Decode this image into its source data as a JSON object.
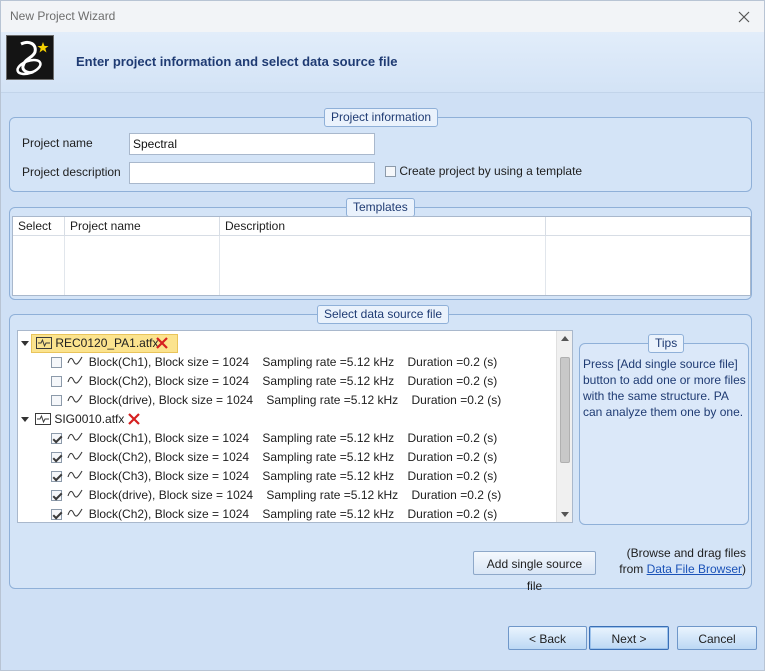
{
  "window": {
    "title": "New Project Wizard"
  },
  "header": {
    "title": "Enter project information and select data source file"
  },
  "project_info": {
    "caption": "Project information",
    "name_label": "Project name",
    "name_value": "Spectral",
    "description_label": "Project description",
    "description_value": "",
    "template_checkbox_label": "Create project by using a template",
    "template_checked": false
  },
  "templates": {
    "caption": "Templates",
    "columns": [
      "Select",
      "Project name",
      "Description",
      ""
    ]
  },
  "data_source": {
    "caption": "Select data source file",
    "files": [
      {
        "name": "REC0120_PA1.atfx",
        "selected": true,
        "blocks": [
          {
            "label": "Block(Ch1), Block size = 1024    Sampling rate =5.12 kHz    Duration =0.2 (s)",
            "checked": false
          },
          {
            "label": "Block(Ch2), Block size = 1024    Sampling rate =5.12 kHz    Duration =0.2 (s)",
            "checked": false
          },
          {
            "label": "Block(drive), Block size = 1024    Sampling rate =5.12 kHz    Duration =0.2 (s)",
            "checked": false
          }
        ]
      },
      {
        "name": "SIG0010.atfx",
        "selected": false,
        "blocks": [
          {
            "label": "Block(Ch1), Block size = 1024    Sampling rate =5.12 kHz    Duration =0.2 (s)",
            "checked": true
          },
          {
            "label": "Block(Ch2), Block size = 1024    Sampling rate =5.12 kHz    Duration =0.2 (s)",
            "checked": true
          },
          {
            "label": "Block(Ch3), Block size = 1024    Sampling rate =5.12 kHz    Duration =0.2 (s)",
            "checked": true
          },
          {
            "label": "Block(drive), Block size = 1024    Sampling rate =5.12 kHz    Duration =0.2 (s)",
            "checked": true
          },
          {
            "label": "Block(Ch2), Block size = 1024    Sampling rate =5.12 kHz    Duration =0.2 (s)",
            "checked": true
          }
        ]
      }
    ],
    "tips_caption": "Tips",
    "tips_text": "Press [Add single source file] button to add one or more files with the same structure. PA can analyze them one by one.",
    "add_button": "Add single source file",
    "browse_hint_1": "(Browse and drag files",
    "browse_hint_2": "from",
    "browse_link": "Data File Browser",
    "browse_hint_3": ")"
  },
  "footer": {
    "back": "< Back",
    "next": "Next >",
    "cancel": "Cancel"
  },
  "colors": {
    "accent": "#1f3b73",
    "selection": "#fbe38e",
    "delete": "#d62020",
    "link": "#1a52b8"
  }
}
